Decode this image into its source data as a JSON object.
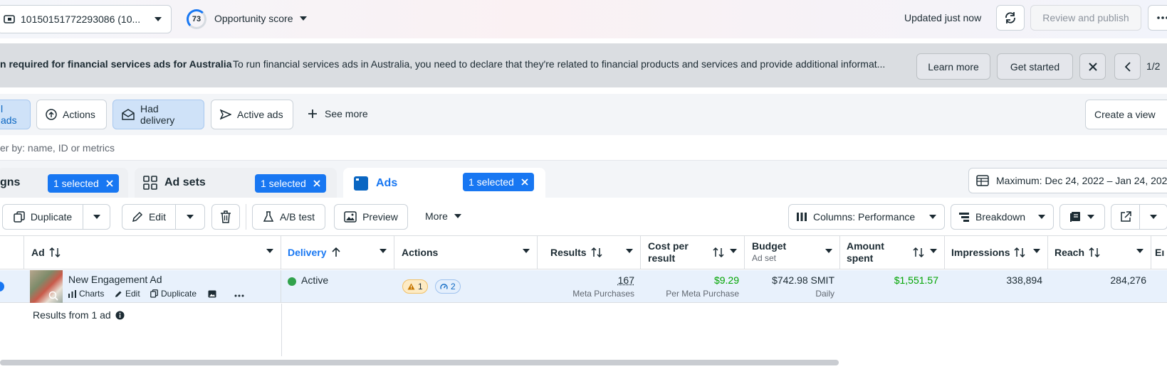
{
  "topbar": {
    "account_id": "10150151772293086 (10...",
    "score": "73",
    "score_label": "Opportunity score",
    "updated": "Updated just now",
    "review_publish": "Review and publish"
  },
  "banner": {
    "title": "n required for financial services ads for Australia",
    "text": "To run financial services ads in Australia, you need to declare that they're related to financial products and services and provide additional informat...",
    "learn_more": "Learn more",
    "get_started": "Get started",
    "pager": "1/2"
  },
  "views": {
    "all_ads": "l ads",
    "actions": "Actions",
    "had_delivery": "Had delivery",
    "active_ads": "Active ads",
    "see_more": "See more",
    "create_view": "Create a view"
  },
  "filter": {
    "placeholder": "er by: name, ID or metrics"
  },
  "levels": {
    "campaigns": "gns",
    "campaigns_selected": "1 selected",
    "adsets": "Ad sets",
    "adsets_selected": "1 selected",
    "ads": "Ads",
    "ads_selected": "1 selected",
    "date_range": "Maximum: Dec 24, 2022 – Jan 24, 202"
  },
  "toolbar": {
    "duplicate": "Duplicate",
    "edit": "Edit",
    "ab_test": "A/B test",
    "preview": "Preview",
    "more": "More",
    "columns": "Columns: Performance",
    "breakdown": "Breakdown"
  },
  "table": {
    "headers": {
      "ad": "Ad",
      "delivery": "Delivery",
      "actions": "Actions",
      "results": "Results",
      "cost_per_result": [
        "Cost per",
        "result"
      ],
      "budget": "Budget",
      "budget_sub": "Ad set",
      "amount_spent": [
        "Amount",
        "spent"
      ],
      "impressions": "Impressions",
      "reach": "Reach",
      "next": "Eı"
    },
    "row": {
      "name": "New Engagement Ad",
      "charts": "Charts",
      "edit": "Edit",
      "duplicate": "Duplicate",
      "delivery": "Active",
      "warnings": "1",
      "recommendations": "2",
      "results": "167",
      "results_sub": "Meta Purchases",
      "cost": "$9.29",
      "cost_sub": "Per Meta Purchase",
      "budget": "$742.98 SMIT",
      "budget_sub": "Daily",
      "spent": "$1,551.57",
      "impressions": "338,894",
      "reach": "284,276"
    },
    "summary": "Results from 1 ad"
  },
  "colors": {
    "accent": "#1877f2",
    "active_green": "#00a400",
    "warning": "#f7b928"
  }
}
